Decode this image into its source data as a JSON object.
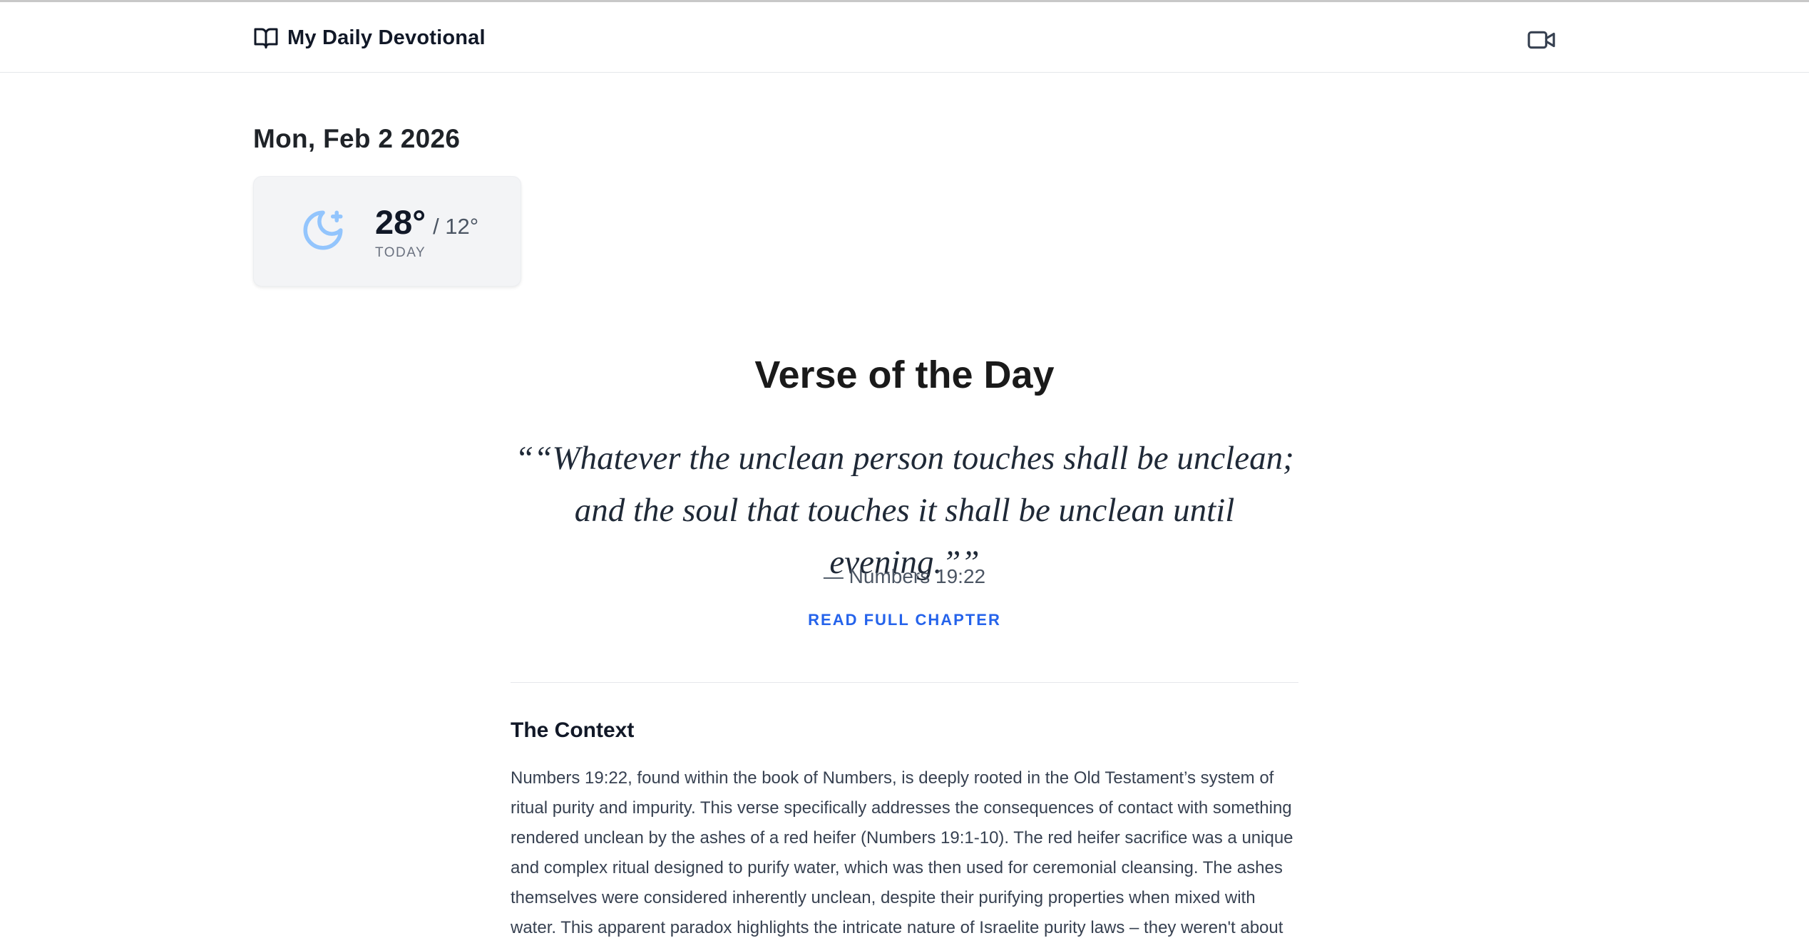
{
  "header": {
    "title": "My Daily Devotional",
    "brand_icon": "book-open-icon",
    "video_icon": "video-camera-icon"
  },
  "date": "Mon, Feb 2 2026",
  "weather": {
    "icon": "moon-star-icon",
    "icon_color": "#93c5fd",
    "high": "28°",
    "low": "/ 12°",
    "label": "TODAY"
  },
  "verse": {
    "heading": "Verse of the Day",
    "line1": "““Whatever the unclean person touches shall be unclean;",
    "line2": "and the soul that touches it shall be unclean until evening.””",
    "reference": "— Numbers 19:22",
    "read_link": "READ FULL CHAPTER",
    "link_color": "#2563eb"
  },
  "context": {
    "title": "The Context",
    "lines": [
      "Numbers 19:22, found within the book of Numbers, is deeply rooted in the Old Testament’s system of",
      "ritual purity and impurity. This verse specifically addresses the consequences of contact with something",
      "rendered unclean by the ashes of a red heifer (Numbers 19:1-10). The red heifer sacrifice was a unique",
      "and complex ritual designed to purify water, which was then used for ceremonial cleansing. The ashes",
      "themselves were considered inherently unclean, despite their purifying properties when mixed with",
      "water. This apparent paradox highlights the intricate nature of Israelite purity laws – they weren't about"
    ]
  }
}
